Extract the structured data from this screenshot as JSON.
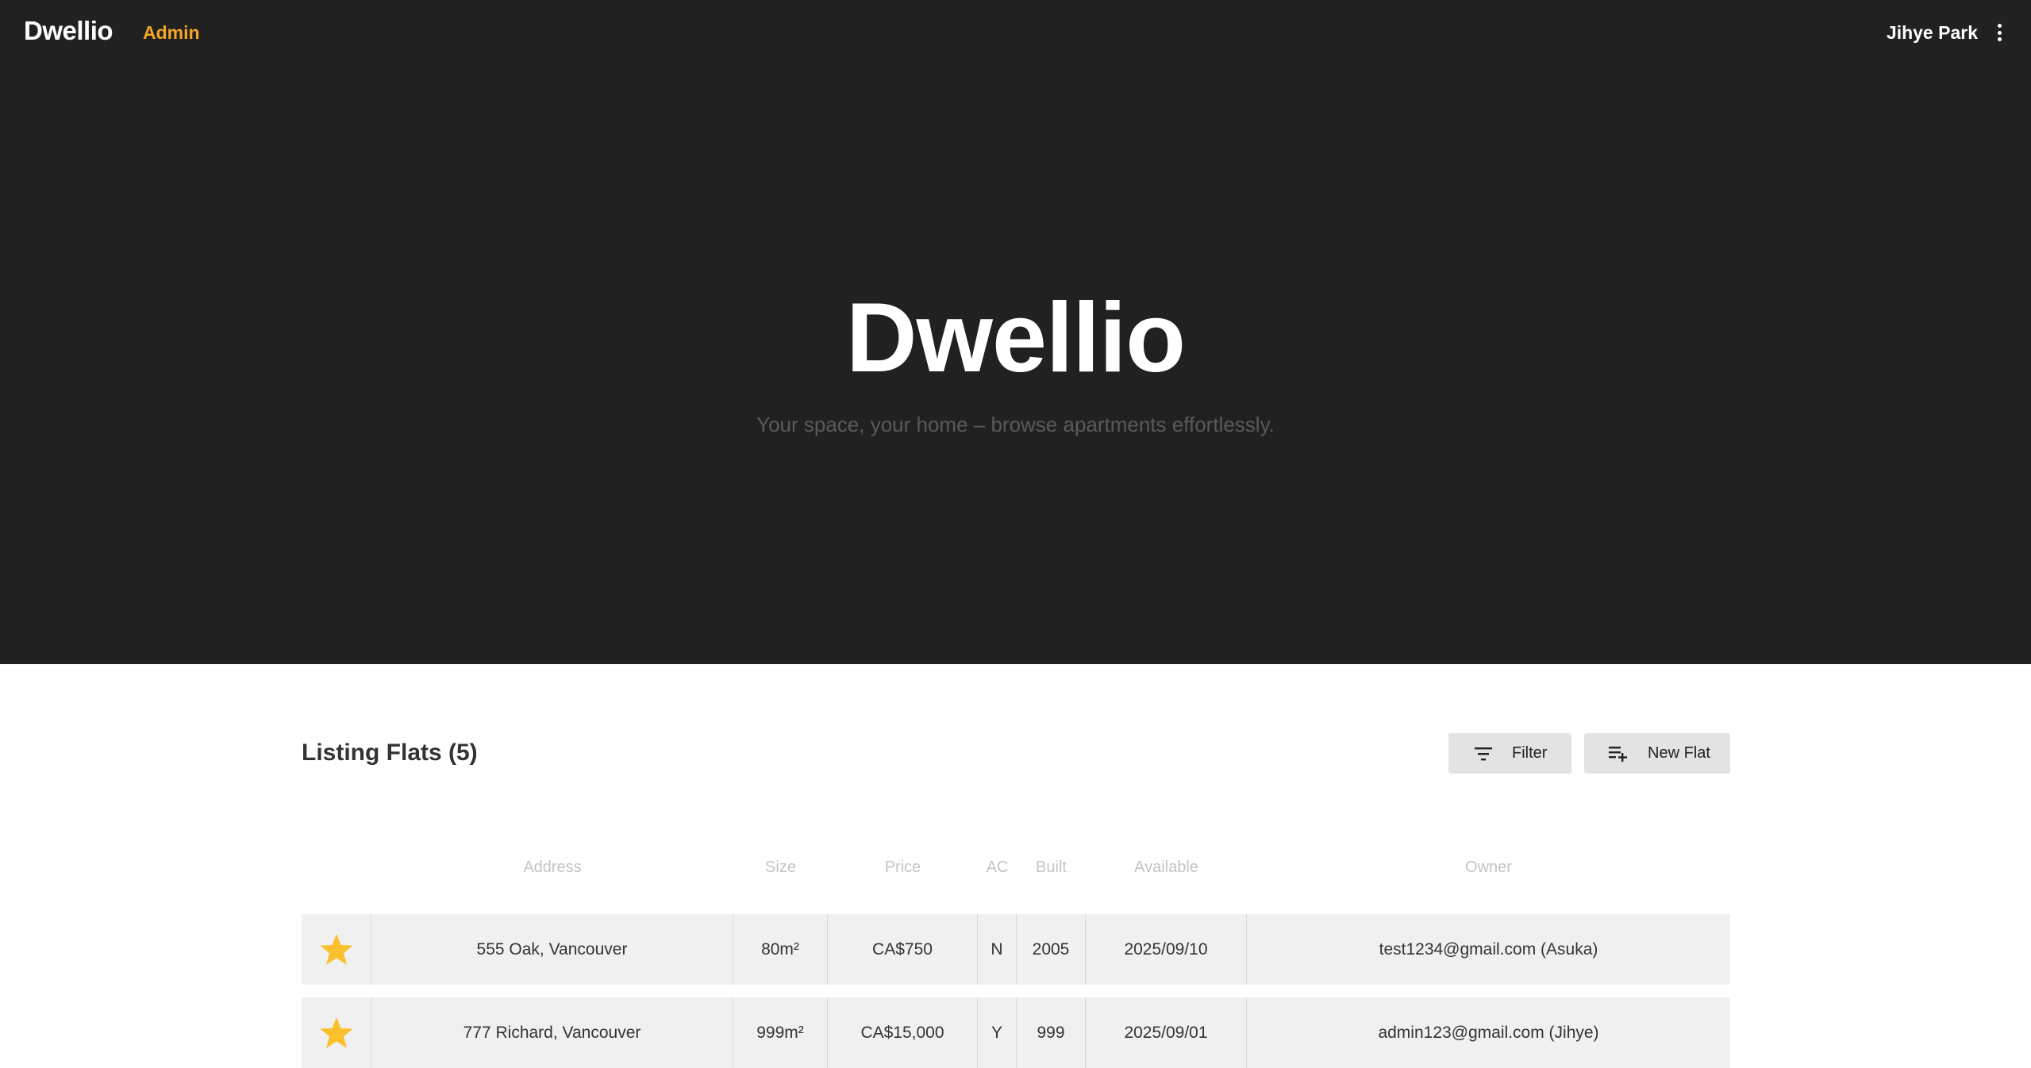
{
  "nav": {
    "logo": "Dwellio",
    "admin_link": "Admin",
    "user_name": "Jihye Park"
  },
  "hero": {
    "title": "Dwellio",
    "subtitle": "Your space, your home – browse apartments effortlessly."
  },
  "listing": {
    "title": "Listing Flats (5)",
    "filter_label": "Filter",
    "new_flat_label": "New Flat",
    "columns": [
      "Address",
      "Size",
      "Price",
      "AC",
      "Built",
      "Available",
      "Owner"
    ],
    "rows": [
      {
        "favorite": true,
        "address": "555 Oak, Vancouver",
        "size": "80m²",
        "price": "CA$750",
        "ac": "N",
        "built": "2005",
        "available": "2025/09/10",
        "owner": "test1234@gmail.com (Asuka)"
      },
      {
        "favorite": true,
        "address": "777 Richard, Vancouver",
        "size": "999m²",
        "price": "CA$15,000",
        "ac": "Y",
        "built": "999",
        "available": "2025/09/01",
        "owner": "admin123@gmail.com (Jihye)"
      }
    ]
  },
  "colors": {
    "hero_bg": "#212121",
    "accent": "#f5a623",
    "star": "#fbc02d",
    "row_bg": "#f0f0f0"
  },
  "icons": [
    "more-vert-icon",
    "filter-icon",
    "playlist-add-icon",
    "star-icon"
  ]
}
